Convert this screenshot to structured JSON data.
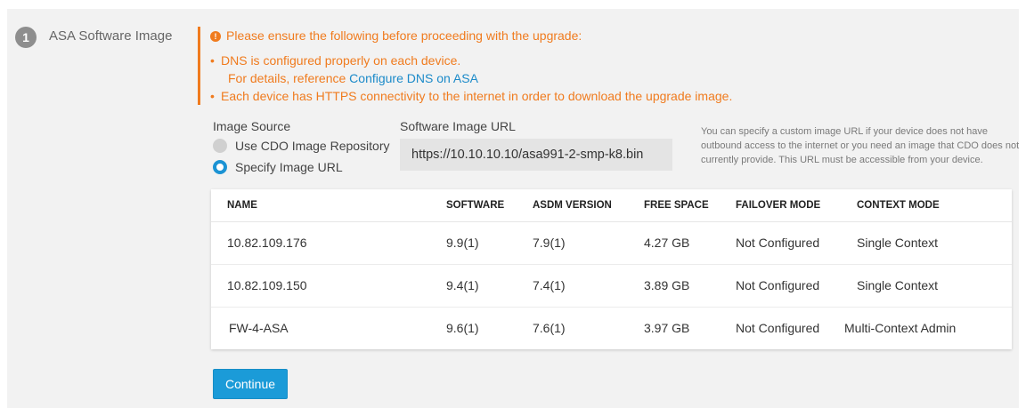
{
  "step": {
    "number": "1",
    "title": "ASA Software Image"
  },
  "warning": {
    "heading": "Please ensure the following before proceeding with the upgrade:",
    "bullet1": "DNS is configured properly on each device.",
    "bullet1_detail_prefix": "For details, reference ",
    "bullet1_link": "Configure DNS on ASA",
    "bullet2": "Each device has HTTPS connectivity to the internet in order to download the upgrade image.",
    "color": "#f07b1e"
  },
  "image_source": {
    "label": "Image Source",
    "options": [
      {
        "label": "Use CDO Image Repository",
        "selected": false
      },
      {
        "label": "Specify Image URL",
        "selected": true
      }
    ]
  },
  "software_url": {
    "label": "Software Image URL",
    "value": "https://10.10.10.10/asa991-2-smp-k8.bin"
  },
  "hint": "You can specify a custom image URL if your device does not have outbound access to the internet or you need an image that CDO does not currently provide. This URL must be accessible from your device.",
  "table": {
    "columns": [
      "NAME",
      "SOFTWARE",
      "ASDM VERSION",
      "FREE SPACE",
      "FAILOVER MODE",
      "CONTEXT MODE"
    ],
    "rows": [
      [
        "10.82.109.176",
        "9.9(1)",
        "7.9(1)",
        "4.27 GB",
        "Not Configured",
        "Single Context"
      ],
      [
        "10.82.109.150",
        "9.4(1)",
        "7.4(1)",
        "3.89 GB",
        "Not Configured",
        "Single Context"
      ],
      [
        "FW-4-ASA",
        "9.6(1)",
        "7.6(1)",
        "3.97 GB",
        "Not Configured",
        "Multi-Context Admin"
      ]
    ]
  },
  "continue_label": "Continue",
  "colors": {
    "accent": "#1b9bd8",
    "warning": "#f07b1e",
    "panel_bg": "#f2f2f2"
  }
}
